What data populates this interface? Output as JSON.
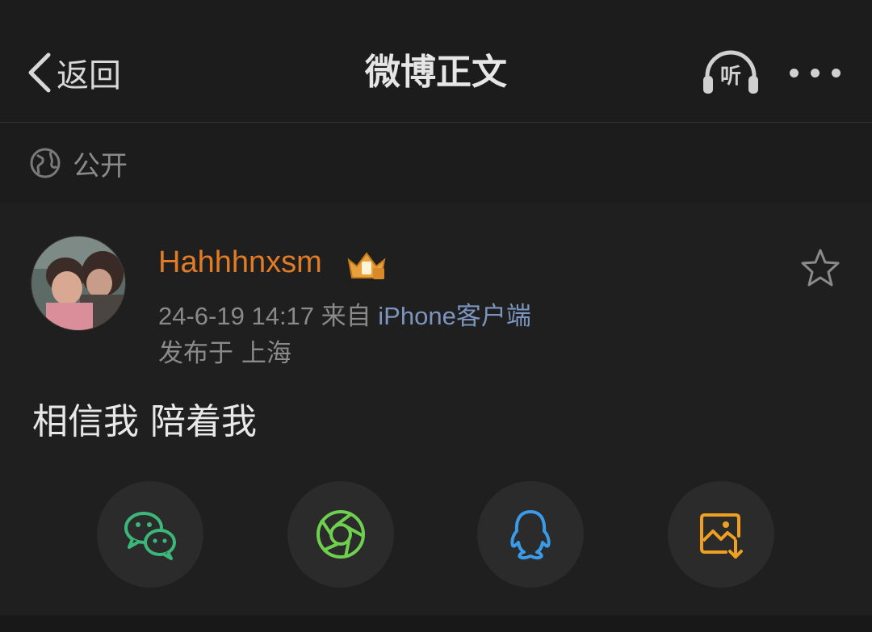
{
  "nav": {
    "back_label": "返回",
    "title": "微博正文",
    "listen_label": "听"
  },
  "visibility": {
    "label": "公开",
    "icon": "globe-icon"
  },
  "post": {
    "username": "Hahhhnxsm",
    "badge": "vip-crown-badge",
    "timestamp": "24-6-19 14:17",
    "source_prefix": "来自",
    "source": "iPhone客户端",
    "location": "发布于 上海",
    "content": "相信我 陪着我"
  },
  "share": {
    "items": [
      {
        "name": "wechat",
        "icon": "wechat-icon",
        "color": "#3cb77a"
      },
      {
        "name": "moments",
        "icon": "moments-aperture-icon",
        "color": "#6fd04f"
      },
      {
        "name": "qq",
        "icon": "qq-icon",
        "color": "#3a9be8"
      },
      {
        "name": "save-image",
        "icon": "save-image-icon",
        "color": "#f0a020"
      }
    ]
  },
  "colors": {
    "background": "#1e1e1e",
    "username": "#e27b26",
    "source_link": "#7c95bf",
    "secondary_text": "#8a8a8a"
  }
}
